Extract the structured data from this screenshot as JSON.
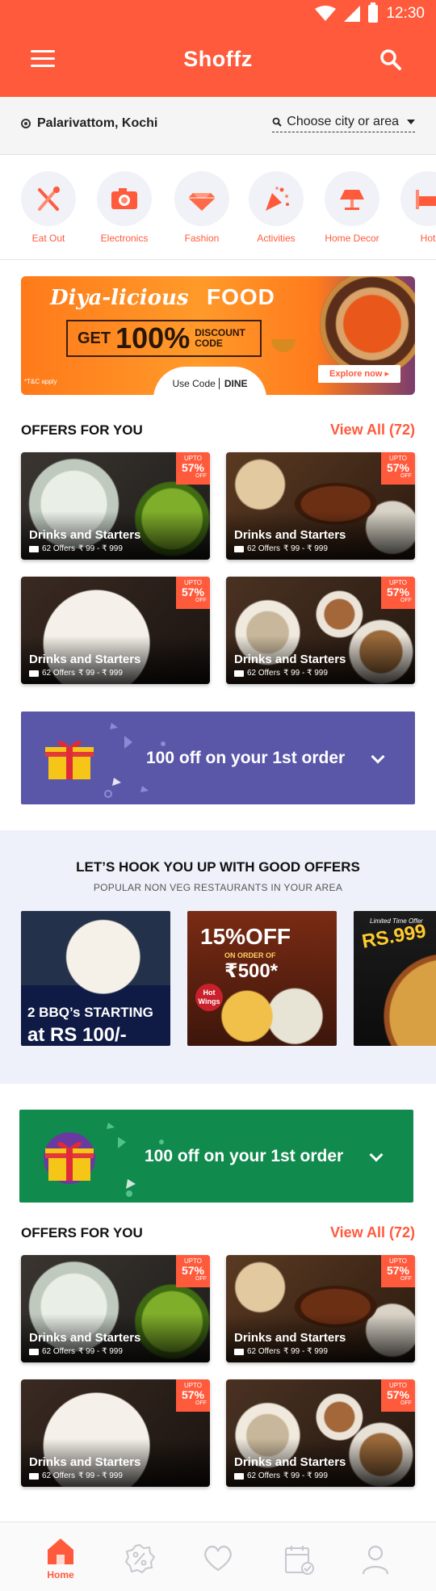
{
  "status_bar": {
    "time": "12:30"
  },
  "header": {
    "title": "Shoffz"
  },
  "location": {
    "current": "Palarivattom, Kochi",
    "picker_label": "Choose city or area"
  },
  "categories": [
    {
      "label": "Eat Out",
      "icon": "fork-knife-icon"
    },
    {
      "label": "Electronics",
      "icon": "camera-icon"
    },
    {
      "label": "Fashion",
      "icon": "diamond-icon"
    },
    {
      "label": "Activities",
      "icon": "party-popper-icon"
    },
    {
      "label": "Home Decor",
      "icon": "lamp-icon"
    },
    {
      "label": "Hot",
      "icon": "hotel-bed-icon"
    }
  ],
  "promo_banner": {
    "title": "Diya-licious",
    "food": "FOOD",
    "get": "GET",
    "percent": "100%",
    "discount_line1": "DISCOUNT",
    "discount_line2": "CODE",
    "use_code_label": "Use Code",
    "code": "DINE",
    "tc": "*T&C apply",
    "explore": "Explore now ▸"
  },
  "offers_section_1": {
    "title": "OFFERS FOR YOU",
    "view_all": "View All (72)",
    "cards": [
      {
        "name": "Drinks and Starters",
        "offers": "62 Offers",
        "price": "₹ 99 - ₹ 999",
        "tag_top": "UPTO",
        "tag_pct": "57%",
        "tag_off": "OFF",
        "photo": "drink"
      },
      {
        "name": "Drinks and Starters",
        "offers": "62 Offers",
        "price": "₹ 99 - ₹ 999",
        "tag_top": "UPTO",
        "tag_pct": "57%",
        "tag_off": "OFF",
        "photo": "steak"
      },
      {
        "name": "Drinks and Starters",
        "offers": "62 Offers",
        "price": "₹ 99 - ₹ 999",
        "tag_top": "UPTO",
        "tag_pct": "57%",
        "tag_off": "OFF",
        "photo": "chicken"
      },
      {
        "name": "Drinks and Starters",
        "offers": "62 Offers",
        "price": "₹ 99 - ₹ 999",
        "tag_top": "UPTO",
        "tag_pct": "57%",
        "tag_off": "OFF",
        "photo": "table"
      }
    ]
  },
  "gift_banner_1": {
    "text": "100 off on your 1st order",
    "color": "#5a57a8"
  },
  "hook_section": {
    "title": "LET’S HOOK YOU UP WITH GOOD OFFERS",
    "subtitle": "POPULAR NON VEG RESTAURANTS IN YOUR AREA",
    "card1": {
      "line1": "2 BBQ’s STARTING",
      "line2": "at RS 100/-"
    },
    "card2": {
      "percent": "15%OFF",
      "sub": "ON ORDER OF",
      "amount": "₹500*",
      "badge_line1": "Hot",
      "badge_line2": "Wings"
    },
    "card3": {
      "limited": "Limited Time Offer",
      "price": "RS.999"
    }
  },
  "gift_banner_2": {
    "text": "100 off on your 1st order",
    "color": "#118a4e"
  },
  "offers_section_2": {
    "title": "OFFERS FOR YOU",
    "view_all": "View All (72)",
    "cards": [
      {
        "name": "Drinks and Starters",
        "offers": "62 Offers",
        "price": "₹ 99 - ₹ 999",
        "tag_top": "UPTO",
        "tag_pct": "57%",
        "tag_off": "OFF",
        "photo": "drink"
      },
      {
        "name": "Drinks and Starters",
        "offers": "62 Offers",
        "price": "₹ 99 - ₹ 999",
        "tag_top": "UPTO",
        "tag_pct": "57%",
        "tag_off": "OFF",
        "photo": "steak"
      },
      {
        "name": "Drinks and Starters",
        "offers": "62 Offers",
        "price": "₹ 99 - ₹ 999",
        "tag_top": "UPTO",
        "tag_pct": "57%",
        "tag_off": "OFF",
        "photo": "chicken"
      },
      {
        "name": "Drinks and Starters",
        "offers": "62 Offers",
        "price": "₹ 99 - ₹ 999",
        "tag_top": "UPTO",
        "tag_pct": "57%",
        "tag_off": "OFF",
        "photo": "table"
      }
    ]
  },
  "bottom_nav": {
    "active_label": "Home",
    "items": [
      "home-icon",
      "badge-percent-icon",
      "heart-icon",
      "calendar-check-icon",
      "user-icon"
    ]
  },
  "colors": {
    "accent": "#ff5a3c",
    "gift_purple": "#5a57a8",
    "gift_green": "#118a4e"
  }
}
